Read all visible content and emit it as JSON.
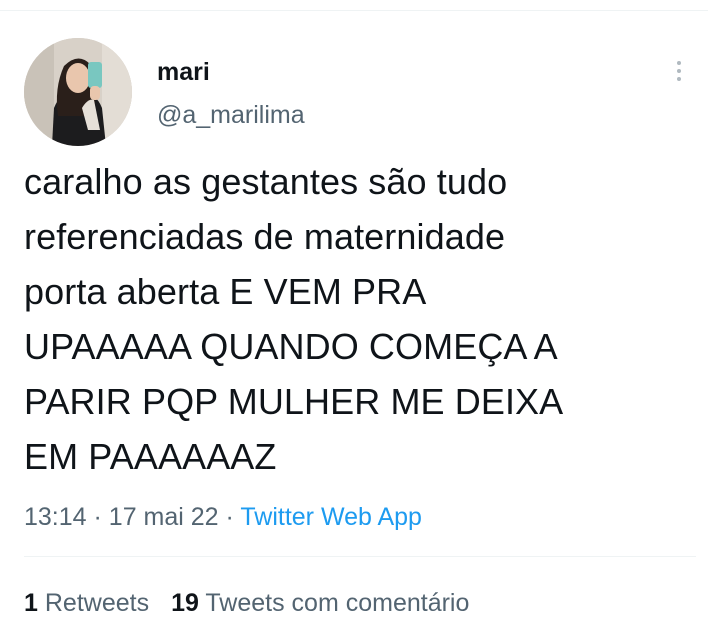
{
  "author": {
    "display_name": "mari",
    "handle": "@a_marilima",
    "avatar": "user-avatar"
  },
  "menu": {
    "icon": "more-vertical-icon"
  },
  "tweet": {
    "text": "caralho as gestantes são tudo\nreferenciadas de maternidade\nporta aberta E VEM PRA\nUPAAAAA QUANDO COMEÇA A\nPARIR PQP MULHER ME DEIXA\nEM PAAAAAAZ",
    "time": "13:14",
    "separator": "·",
    "date": "17 mai 22",
    "source": "Twitter Web App"
  },
  "stats": {
    "retweets_count": "1",
    "retweets_label": "Retweets",
    "quotes_count": "19",
    "quotes_label": "Tweets com comentário"
  },
  "colors": {
    "text_primary": "#0f1419",
    "text_secondary": "#536471",
    "link": "#1d9bf0",
    "divider": "#eff3f4"
  }
}
